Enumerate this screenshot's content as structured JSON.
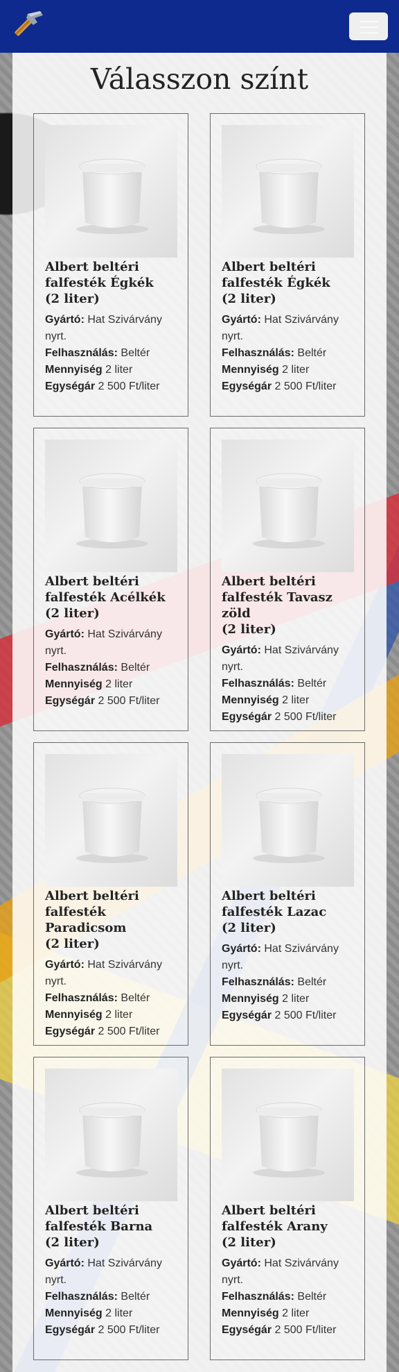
{
  "navbar": {
    "brand_icon": "hammer-icon",
    "menu_icon": "hamburger-menu-icon"
  },
  "page": {
    "title": "Válasszon színt"
  },
  "labels": {
    "gyarto": "Gyártó:",
    "felhasznalas": "Felhasználás:",
    "mennyiseg": "Mennyiség",
    "egysegar": "Egységár"
  },
  "products": [
    {
      "name_l1": "Albert beltéri",
      "name_l2": "falfesték Égkék",
      "name_l3": "(2 liter)",
      "manufacturer_l1": "Hat Szivárvány",
      "manufacturer_l2": "nyrt.",
      "usage": "Beltér",
      "quantity": "2 liter",
      "unit_price": "2 500 Ft/liter"
    },
    {
      "name_l1": "Albert beltéri",
      "name_l2": "falfesték Égkék",
      "name_l3": "(2 liter)",
      "manufacturer_l1": "Hat Szivárvány",
      "manufacturer_l2": "nyrt.",
      "usage": "Beltér",
      "quantity": "2 liter",
      "unit_price": "2 500 Ft/liter"
    },
    {
      "name_l1": "Albert beltéri",
      "name_l2": "falfesték Acélkék",
      "name_l3": "(2 liter)",
      "manufacturer_l1": "Hat Szivárvány",
      "manufacturer_l2": "nyrt.",
      "usage": "Beltér",
      "quantity": "2 liter",
      "unit_price": "2 500 Ft/liter"
    },
    {
      "name_l1": "Albert beltéri",
      "name_l2": "falfesték Tavasz zöld",
      "name_l3": "(2 liter)",
      "manufacturer_l1": "Hat Szivárvány",
      "manufacturer_l2": "nyrt.",
      "usage": "Beltér",
      "quantity": "2 liter",
      "unit_price": "2 500 Ft/liter"
    },
    {
      "name_l1": "Albert beltéri",
      "name_l2": "falfesték Paradicsom",
      "name_l3": "(2 liter)",
      "manufacturer_l1": "Hat Szivárvány",
      "manufacturer_l2": "nyrt.",
      "usage": "Beltér",
      "quantity": "2 liter",
      "unit_price": "2 500 Ft/liter"
    },
    {
      "name_l1": "Albert beltéri",
      "name_l2": "falfesték Lazac",
      "name_l3": "(2 liter)",
      "manufacturer_l1": "Hat Szivárvány",
      "manufacturer_l2": "nyrt.",
      "usage": "Beltér",
      "quantity": "2 liter",
      "unit_price": "2 500 Ft/liter"
    },
    {
      "name_l1": "Albert beltéri",
      "name_l2": "falfesték Barna",
      "name_l3": "(2 liter)",
      "manufacturer_l1": "Hat Szivárvány",
      "manufacturer_l2": "nyrt.",
      "usage": "Beltér",
      "quantity": "2 liter",
      "unit_price": "2 500 Ft/liter"
    },
    {
      "name_l1": "Albert beltéri",
      "name_l2": "falfesték Arany",
      "name_l3": "(2 liter)",
      "manufacturer_l1": "Hat Szivárvány",
      "manufacturer_l2": "nyrt.",
      "usage": "Beltér",
      "quantity": "2 liter",
      "unit_price": "2 500 Ft/liter"
    }
  ],
  "colors": {
    "navbar": "#0e2a8f",
    "card_border": "#6a6a6a"
  }
}
